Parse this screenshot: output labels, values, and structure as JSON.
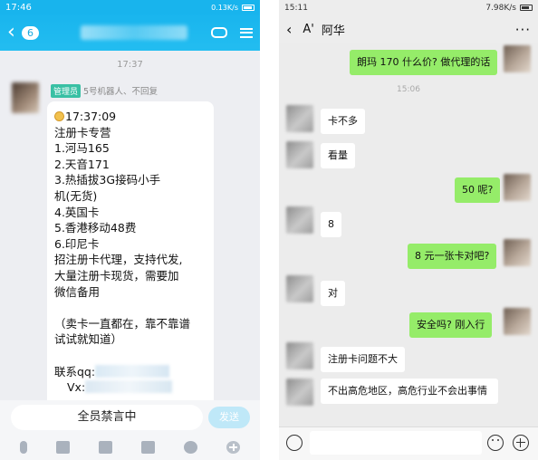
{
  "left": {
    "status_time": "17:46",
    "status_right": "0.13K/s",
    "unread_badge": "6",
    "time_divider": "17:37",
    "admin_tag": "管理员",
    "sender_name": "5号机器人、不回复",
    "message_lines": [
      "17:37:09",
      "注册卡专营",
      "1.河马165",
      "2.天音171",
      "3.热插拔3G接码小手",
      "机(无货)",
      "4.英国卡",
      "5.香港移动48费",
      "6.印尼卡",
      "招注册卡代理，支持代发,",
      "大量注册卡现货，需要加",
      "微信备用",
      "",
      "（卖卡一直都在，靠不靠谱",
      "试试就知道）",
      "",
      "联系qq:",
      "Vx:"
    ],
    "input_label": "全员禁言中",
    "send_label": "发送",
    "tool_icons": [
      "mic-icon",
      "image-icon",
      "camera-icon",
      "red-packet-icon",
      "emoji-icon",
      "plus-icon"
    ],
    "header_color": "#18b4ed"
  },
  "right": {
    "status_time": "15:11",
    "status_right": "7.98K/s",
    "contact_name": "阿华",
    "contact_prefix": "A'",
    "more_label": "···",
    "timestamp": "15:06",
    "messages": [
      {
        "side": "right",
        "text": "朗玛 170 什么价? 做代理的话"
      },
      {
        "side": "left",
        "text": "卡不多"
      },
      {
        "side": "left",
        "text": "看量"
      },
      {
        "side": "right",
        "text": "50 呢?"
      },
      {
        "side": "left",
        "text": "8"
      },
      {
        "side": "right",
        "text": "8 元一张卡对吧?"
      },
      {
        "side": "left",
        "text": "对"
      },
      {
        "side": "right",
        "text": "安全吗? 刚入行"
      },
      {
        "side": "left",
        "text": "注册卡问题不大"
      },
      {
        "side": "left",
        "text": "不出高危地区，高危行业不会出事情"
      }
    ],
    "sent_color": "#95ec69"
  }
}
